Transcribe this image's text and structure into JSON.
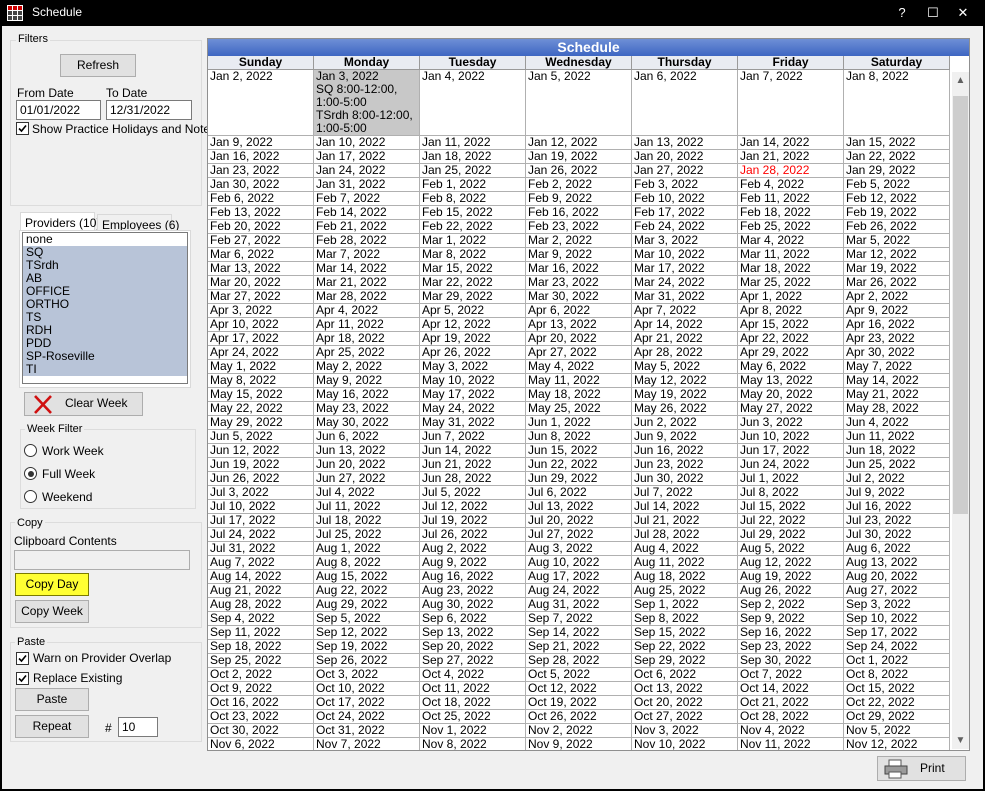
{
  "window": {
    "title": "Schedule",
    "help": "?",
    "maximize": "☐",
    "close": "✕"
  },
  "filters": {
    "label": "Filters",
    "refresh": "Refresh",
    "from_label": "From Date",
    "to_label": "To Date",
    "from_value": "01/01/2022",
    "to_value": "12/31/2022",
    "show_holidays": "Show Practice Holidays and Notes"
  },
  "tabs": {
    "providers": "Providers (10)",
    "employees": "Employees (6)"
  },
  "providers": [
    {
      "name": "none",
      "selected": false
    },
    {
      "name": "SQ",
      "selected": true
    },
    {
      "name": "TSrdh",
      "selected": true
    },
    {
      "name": "AB",
      "selected": true
    },
    {
      "name": "OFFICE",
      "selected": true
    },
    {
      "name": "ORTHO",
      "selected": true
    },
    {
      "name": "TS",
      "selected": true
    },
    {
      "name": "RDH",
      "selected": true
    },
    {
      "name": "PDD",
      "selected": true
    },
    {
      "name": "SP-Roseville",
      "selected": true
    },
    {
      "name": "TI",
      "selected": true
    }
  ],
  "clear_week": "Clear Week",
  "week_filter": {
    "label": "Week Filter",
    "work": "Work Week",
    "full": "Full Week",
    "weekend": "Weekend",
    "selected": "full"
  },
  "copy": {
    "label": "Copy",
    "clipboard_label": "Clipboard Contents",
    "clipboard_value": "",
    "copy_day": "Copy Day",
    "copy_week": "Copy Week"
  },
  "paste": {
    "label": "Paste",
    "warn": "Warn on Provider Overlap",
    "replace": "Replace Existing",
    "paste": "Paste",
    "repeat": "Repeat",
    "hash": "#",
    "repeat_count": "10"
  },
  "print": "Print",
  "schedule": {
    "title": "Schedule",
    "days": [
      "Sunday",
      "Monday",
      "Tuesday",
      "Wednesday",
      "Thursday",
      "Friday",
      "Saturday"
    ],
    "first_week": [
      "Jan 2, 2022",
      "Jan 3, 2022\nSQ 8:00-12:00, 1:00-5:00\nTSrdh 8:00-12:00, 1:00-5:00",
      "Jan 4, 2022",
      "Jan 5, 2022",
      "Jan 6, 2022",
      "Jan 7, 2022",
      "Jan 8, 2022"
    ],
    "weeks": [
      [
        "Jan 9, 2022",
        "Jan 10, 2022",
        "Jan 11, 2022",
        "Jan 12, 2022",
        "Jan 13, 2022",
        "Jan 14, 2022",
        "Jan 15, 2022"
      ],
      [
        "Jan 16, 2022",
        "Jan 17, 2022",
        "Jan 18, 2022",
        "Jan 19, 2022",
        "Jan 20, 2022",
        "Jan 21, 2022",
        "Jan 22, 2022"
      ],
      [
        "Jan 23, 2022",
        "Jan 24, 2022",
        "Jan 25, 2022",
        "Jan 26, 2022",
        "Jan 27, 2022",
        "Jan 28, 2022",
        "Jan 29, 2022"
      ],
      [
        "Jan 30, 2022",
        "Jan 31, 2022",
        "Feb 1, 2022",
        "Feb 2, 2022",
        "Feb 3, 2022",
        "Feb 4, 2022",
        "Feb 5, 2022"
      ],
      [
        "Feb 6, 2022",
        "Feb 7, 2022",
        "Feb 8, 2022",
        "Feb 9, 2022",
        "Feb 10, 2022",
        "Feb 11, 2022",
        "Feb 12, 2022"
      ],
      [
        "Feb 13, 2022",
        "Feb 14, 2022",
        "Feb 15, 2022",
        "Feb 16, 2022",
        "Feb 17, 2022",
        "Feb 18, 2022",
        "Feb 19, 2022"
      ],
      [
        "Feb 20, 2022",
        "Feb 21, 2022",
        "Feb 22, 2022",
        "Feb 23, 2022",
        "Feb 24, 2022",
        "Feb 25, 2022",
        "Feb 26, 2022"
      ],
      [
        "Feb 27, 2022",
        "Feb 28, 2022",
        "Mar 1, 2022",
        "Mar 2, 2022",
        "Mar 3, 2022",
        "Mar 4, 2022",
        "Mar 5, 2022"
      ],
      [
        "Mar 6, 2022",
        "Mar 7, 2022",
        "Mar 8, 2022",
        "Mar 9, 2022",
        "Mar 10, 2022",
        "Mar 11, 2022",
        "Mar 12, 2022"
      ],
      [
        "Mar 13, 2022",
        "Mar 14, 2022",
        "Mar 15, 2022",
        "Mar 16, 2022",
        "Mar 17, 2022",
        "Mar 18, 2022",
        "Mar 19, 2022"
      ],
      [
        "Mar 20, 2022",
        "Mar 21, 2022",
        "Mar 22, 2022",
        "Mar 23, 2022",
        "Mar 24, 2022",
        "Mar 25, 2022",
        "Mar 26, 2022"
      ],
      [
        "Mar 27, 2022",
        "Mar 28, 2022",
        "Mar 29, 2022",
        "Mar 30, 2022",
        "Mar 31, 2022",
        "Apr 1, 2022",
        "Apr 2, 2022"
      ],
      [
        "Apr 3, 2022",
        "Apr 4, 2022",
        "Apr 5, 2022",
        "Apr 6, 2022",
        "Apr 7, 2022",
        "Apr 8, 2022",
        "Apr 9, 2022"
      ],
      [
        "Apr 10, 2022",
        "Apr 11, 2022",
        "Apr 12, 2022",
        "Apr 13, 2022",
        "Apr 14, 2022",
        "Apr 15, 2022",
        "Apr 16, 2022"
      ],
      [
        "Apr 17, 2022",
        "Apr 18, 2022",
        "Apr 19, 2022",
        "Apr 20, 2022",
        "Apr 21, 2022",
        "Apr 22, 2022",
        "Apr 23, 2022"
      ],
      [
        "Apr 24, 2022",
        "Apr 25, 2022",
        "Apr 26, 2022",
        "Apr 27, 2022",
        "Apr 28, 2022",
        "Apr 29, 2022",
        "Apr 30, 2022"
      ],
      [
        "May 1, 2022",
        "May 2, 2022",
        "May 3, 2022",
        "May 4, 2022",
        "May 5, 2022",
        "May 6, 2022",
        "May 7, 2022"
      ],
      [
        "May 8, 2022",
        "May 9, 2022",
        "May 10, 2022",
        "May 11, 2022",
        "May 12, 2022",
        "May 13, 2022",
        "May 14, 2022"
      ],
      [
        "May 15, 2022",
        "May 16, 2022",
        "May 17, 2022",
        "May 18, 2022",
        "May 19, 2022",
        "May 20, 2022",
        "May 21, 2022"
      ],
      [
        "May 22, 2022",
        "May 23, 2022",
        "May 24, 2022",
        "May 25, 2022",
        "May 26, 2022",
        "May 27, 2022",
        "May 28, 2022"
      ],
      [
        "May 29, 2022",
        "May 30, 2022",
        "May 31, 2022",
        "Jun 1, 2022",
        "Jun 2, 2022",
        "Jun 3, 2022",
        "Jun 4, 2022"
      ],
      [
        "Jun 5, 2022",
        "Jun 6, 2022",
        "Jun 7, 2022",
        "Jun 8, 2022",
        "Jun 9, 2022",
        "Jun 10, 2022",
        "Jun 11, 2022"
      ],
      [
        "Jun 12, 2022",
        "Jun 13, 2022",
        "Jun 14, 2022",
        "Jun 15, 2022",
        "Jun 16, 2022",
        "Jun 17, 2022",
        "Jun 18, 2022"
      ],
      [
        "Jun 19, 2022",
        "Jun 20, 2022",
        "Jun 21, 2022",
        "Jun 22, 2022",
        "Jun 23, 2022",
        "Jun 24, 2022",
        "Jun 25, 2022"
      ],
      [
        "Jun 26, 2022",
        "Jun 27, 2022",
        "Jun 28, 2022",
        "Jun 29, 2022",
        "Jun 30, 2022",
        "Jul 1, 2022",
        "Jul 2, 2022"
      ],
      [
        "Jul 3, 2022",
        "Jul 4, 2022",
        "Jul 5, 2022",
        "Jul 6, 2022",
        "Jul 7, 2022",
        "Jul 8, 2022",
        "Jul 9, 2022"
      ],
      [
        "Jul 10, 2022",
        "Jul 11, 2022",
        "Jul 12, 2022",
        "Jul 13, 2022",
        "Jul 14, 2022",
        "Jul 15, 2022",
        "Jul 16, 2022"
      ],
      [
        "Jul 17, 2022",
        "Jul 18, 2022",
        "Jul 19, 2022",
        "Jul 20, 2022",
        "Jul 21, 2022",
        "Jul 22, 2022",
        "Jul 23, 2022"
      ],
      [
        "Jul 24, 2022",
        "Jul 25, 2022",
        "Jul 26, 2022",
        "Jul 27, 2022",
        "Jul 28, 2022",
        "Jul 29, 2022",
        "Jul 30, 2022"
      ],
      [
        "Jul 31, 2022",
        "Aug 1, 2022",
        "Aug 2, 2022",
        "Aug 3, 2022",
        "Aug 4, 2022",
        "Aug 5, 2022",
        "Aug 6, 2022"
      ],
      [
        "Aug 7, 2022",
        "Aug 8, 2022",
        "Aug 9, 2022",
        "Aug 10, 2022",
        "Aug 11, 2022",
        "Aug 12, 2022",
        "Aug 13, 2022"
      ],
      [
        "Aug 14, 2022",
        "Aug 15, 2022",
        "Aug 16, 2022",
        "Aug 17, 2022",
        "Aug 18, 2022",
        "Aug 19, 2022",
        "Aug 20, 2022"
      ],
      [
        "Aug 21, 2022",
        "Aug 22, 2022",
        "Aug 23, 2022",
        "Aug 24, 2022",
        "Aug 25, 2022",
        "Aug 26, 2022",
        "Aug 27, 2022"
      ],
      [
        "Aug 28, 2022",
        "Aug 29, 2022",
        "Aug 30, 2022",
        "Aug 31, 2022",
        "Sep 1, 2022",
        "Sep 2, 2022",
        "Sep 3, 2022"
      ],
      [
        "Sep 4, 2022",
        "Sep 5, 2022",
        "Sep 6, 2022",
        "Sep 7, 2022",
        "Sep 8, 2022",
        "Sep 9, 2022",
        "Sep 10, 2022"
      ],
      [
        "Sep 11, 2022",
        "Sep 12, 2022",
        "Sep 13, 2022",
        "Sep 14, 2022",
        "Sep 15, 2022",
        "Sep 16, 2022",
        "Sep 17, 2022"
      ],
      [
        "Sep 18, 2022",
        "Sep 19, 2022",
        "Sep 20, 2022",
        "Sep 21, 2022",
        "Sep 22, 2022",
        "Sep 23, 2022",
        "Sep 24, 2022"
      ],
      [
        "Sep 25, 2022",
        "Sep 26, 2022",
        "Sep 27, 2022",
        "Sep 28, 2022",
        "Sep 29, 2022",
        "Sep 30, 2022",
        "Oct 1, 2022"
      ],
      [
        "Oct 2, 2022",
        "Oct 3, 2022",
        "Oct 4, 2022",
        "Oct 5, 2022",
        "Oct 6, 2022",
        "Oct 7, 2022",
        "Oct 8, 2022"
      ],
      [
        "Oct 9, 2022",
        "Oct 10, 2022",
        "Oct 11, 2022",
        "Oct 12, 2022",
        "Oct 13, 2022",
        "Oct 14, 2022",
        "Oct 15, 2022"
      ],
      [
        "Oct 16, 2022",
        "Oct 17, 2022",
        "Oct 18, 2022",
        "Oct 19, 2022",
        "Oct 20, 2022",
        "Oct 21, 2022",
        "Oct 22, 2022"
      ],
      [
        "Oct 23, 2022",
        "Oct 24, 2022",
        "Oct 25, 2022",
        "Oct 26, 2022",
        "Oct 27, 2022",
        "Oct 28, 2022",
        "Oct 29, 2022"
      ],
      [
        "Oct 30, 2022",
        "Oct 31, 2022",
        "Nov 1, 2022",
        "Nov 2, 2022",
        "Nov 3, 2022",
        "Nov 4, 2022",
        "Nov 5, 2022"
      ],
      [
        "Nov 6, 2022",
        "Nov 7, 2022",
        "Nov 8, 2022",
        "Nov 9, 2022",
        "Nov 10, 2022",
        "Nov 11, 2022",
        "Nov 12, 2022"
      ]
    ],
    "highlight_gray": "Jan 3, 2022",
    "highlight_red": "Jan 28, 2022"
  },
  "colors": {
    "selection": "#b8c4d8",
    "accent_header": "#4a6fc7",
    "copy_day_bg": "#ffff33",
    "holiday_text": "#ff0000"
  }
}
